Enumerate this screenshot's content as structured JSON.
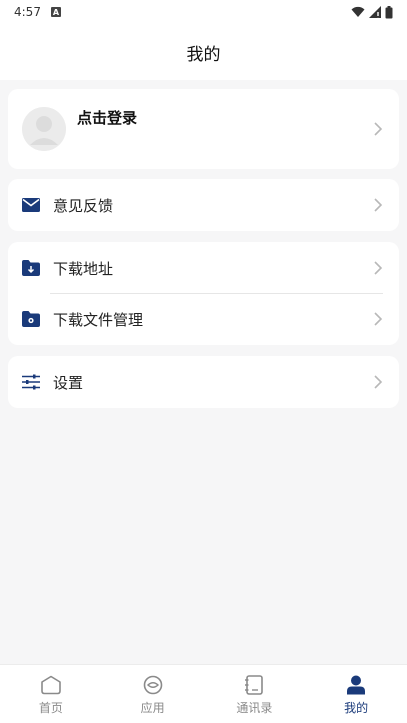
{
  "status_bar": {
    "time": "4:57",
    "notification_badge": "A"
  },
  "header": {
    "title": "我的"
  },
  "profile": {
    "login_label": "点击登录"
  },
  "menu": {
    "feedback": "意见反馈",
    "download_address": "下载地址",
    "download_file_manage": "下载文件管理",
    "settings": "设置"
  },
  "tabbar": {
    "tabs": [
      {
        "label": "首页",
        "icon": "home-icon"
      },
      {
        "label": "应用",
        "icon": "apps-icon"
      },
      {
        "label": "通讯录",
        "icon": "contacts-icon"
      },
      {
        "label": "我的",
        "icon": "profile-icon"
      }
    ],
    "active_index": 3
  },
  "colors": {
    "accent": "#1a3a7a",
    "background": "#f6f6f7",
    "chevron": "#b8b8b8"
  }
}
